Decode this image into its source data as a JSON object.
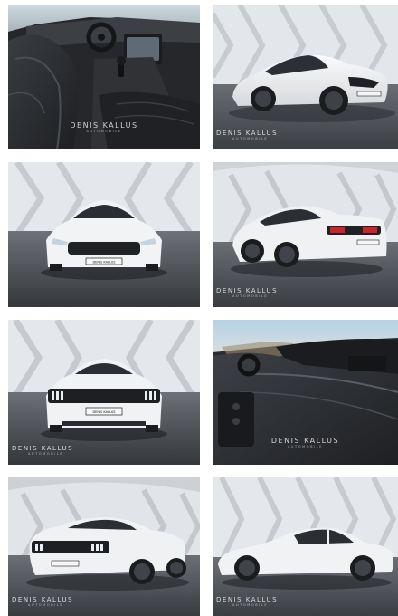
{
  "gallery": {
    "watermark": {
      "brand": "DENIS KALLUS",
      "sub": "AUTOMOBILE"
    },
    "plate": "DENIS KALLUS",
    "photos": [
      {
        "id": "p1",
        "view": "interior-driver-seat"
      },
      {
        "id": "p2",
        "view": "exterior-front-right"
      },
      {
        "id": "p3",
        "view": "exterior-front"
      },
      {
        "id": "p4",
        "view": "exterior-rear-left"
      },
      {
        "id": "p5",
        "view": "exterior-rear"
      },
      {
        "id": "p6",
        "view": "interior-dashboard"
      },
      {
        "id": "p7",
        "view": "exterior-rear-three-quarter"
      },
      {
        "id": "p8",
        "view": "exterior-side-left"
      }
    ]
  },
  "colors": {
    "car_body": "#f1f2f2",
    "studio_wall": "#e3e6ea",
    "studio_floor": "#4b4f55",
    "leather": "#2a2c30"
  }
}
